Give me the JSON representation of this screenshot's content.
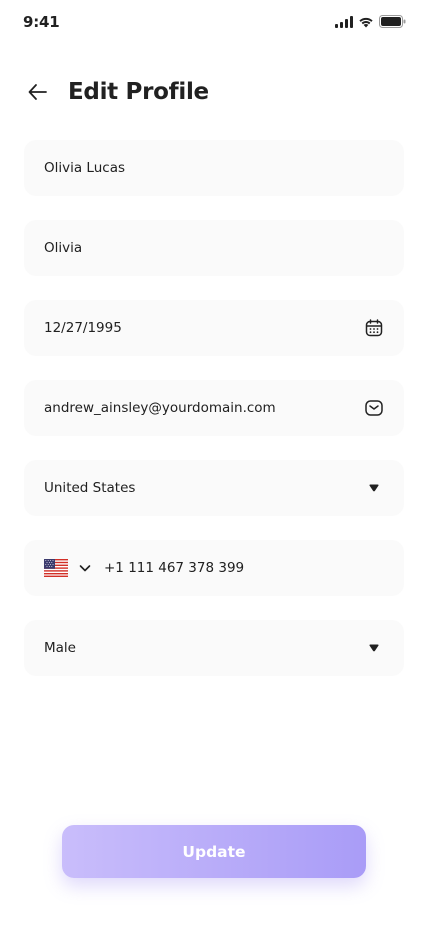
{
  "status_bar": {
    "time": "9:41"
  },
  "header": {
    "title": "Edit Profile"
  },
  "fields": {
    "full_name": "Olivia Lucas",
    "nickname": "Olivia",
    "dob": "12/27/1995",
    "email": "andrew_ainsley@yourdomain.com",
    "country": "United States",
    "phone": "+1 111 467 378 399",
    "gender": "Male"
  },
  "icons": {
    "back": "arrow-left-icon",
    "calendar": "calendar-icon",
    "email": "envelope-icon",
    "dropdown": "caret-down-icon",
    "flag": "us-flag-icon",
    "chevron": "chevron-down-icon"
  },
  "button": {
    "update_label": "Update"
  },
  "colors": {
    "accent_start": "#c9bdfb",
    "accent_end": "#a99cf7",
    "field_bg": "#fafafa",
    "text": "#212121"
  }
}
